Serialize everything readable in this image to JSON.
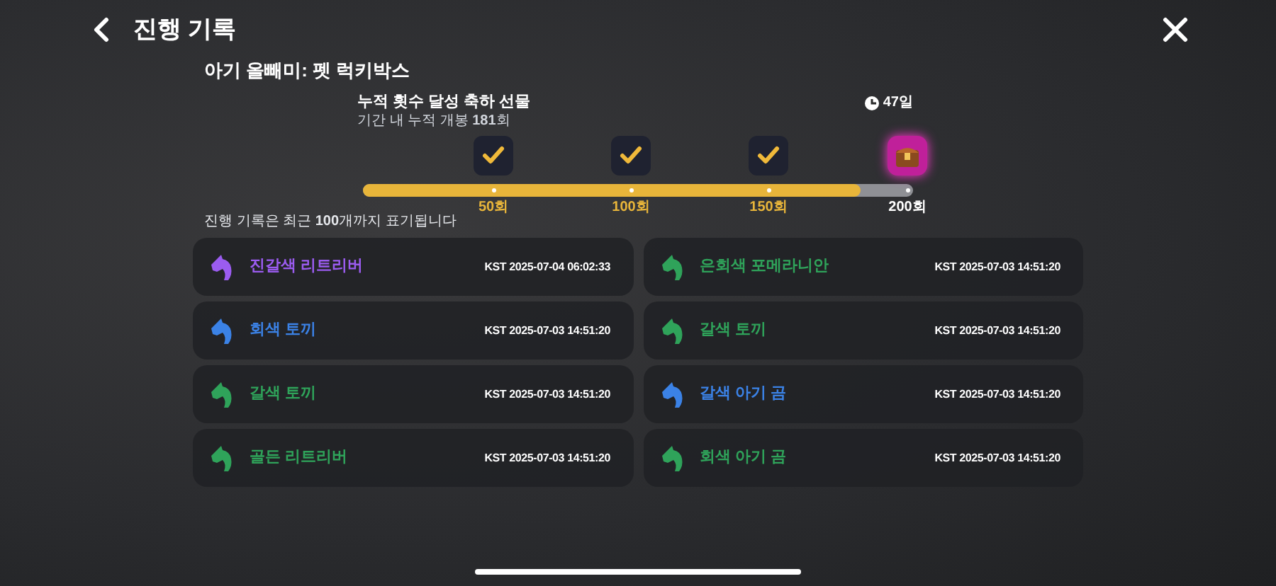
{
  "header": {
    "title": "진행 기록"
  },
  "subtitle": "아기 올빼미: 펫 럭키박스",
  "reward": {
    "title": "누적 횟수 달성 축하 선물",
    "progress_text": "기간 내 누적 개봉 **181**회",
    "time_left": "47일",
    "level": 0.905,
    "milestones": [
      {
        "label": "50회",
        "reached": true
      },
      {
        "label": "100회",
        "reached": true
      },
      {
        "label": "150회",
        "reached": true
      },
      {
        "label": "200회",
        "reached": false
      }
    ]
  },
  "notice": "진행 기록은 최근 **100**개까지 표기됩니다",
  "records": [
    {
      "name": "진갈색 리트리버",
      "time": "KST 2025-07-04 06:02:33",
      "color": "#9b5cf0"
    },
    {
      "name": "은회색 포메라니안",
      "time": "KST 2025-07-03 14:51:20",
      "color": "#2fa35a"
    },
    {
      "name": "회색 토끼",
      "time": "KST 2025-07-03 14:51:20",
      "color": "#3b82e6"
    },
    {
      "name": "갈색 토끼",
      "time": "KST 2025-07-03 14:51:20",
      "color": "#2fa35a"
    },
    {
      "name": "갈색 토끼",
      "time": "KST 2025-07-03 14:51:20",
      "color": "#2fa35a"
    },
    {
      "name": "갈색 아기 곰",
      "time": "KST 2025-07-03 14:51:20",
      "color": "#3b82e6"
    },
    {
      "name": "골든 리트리버",
      "time": "KST 2025-07-03 14:51:20",
      "color": "#2fa35a"
    },
    {
      "name": "회색 아기 곰",
      "time": "KST 2025-07-03 14:51:20",
      "color": "#2fa35a"
    }
  ]
}
